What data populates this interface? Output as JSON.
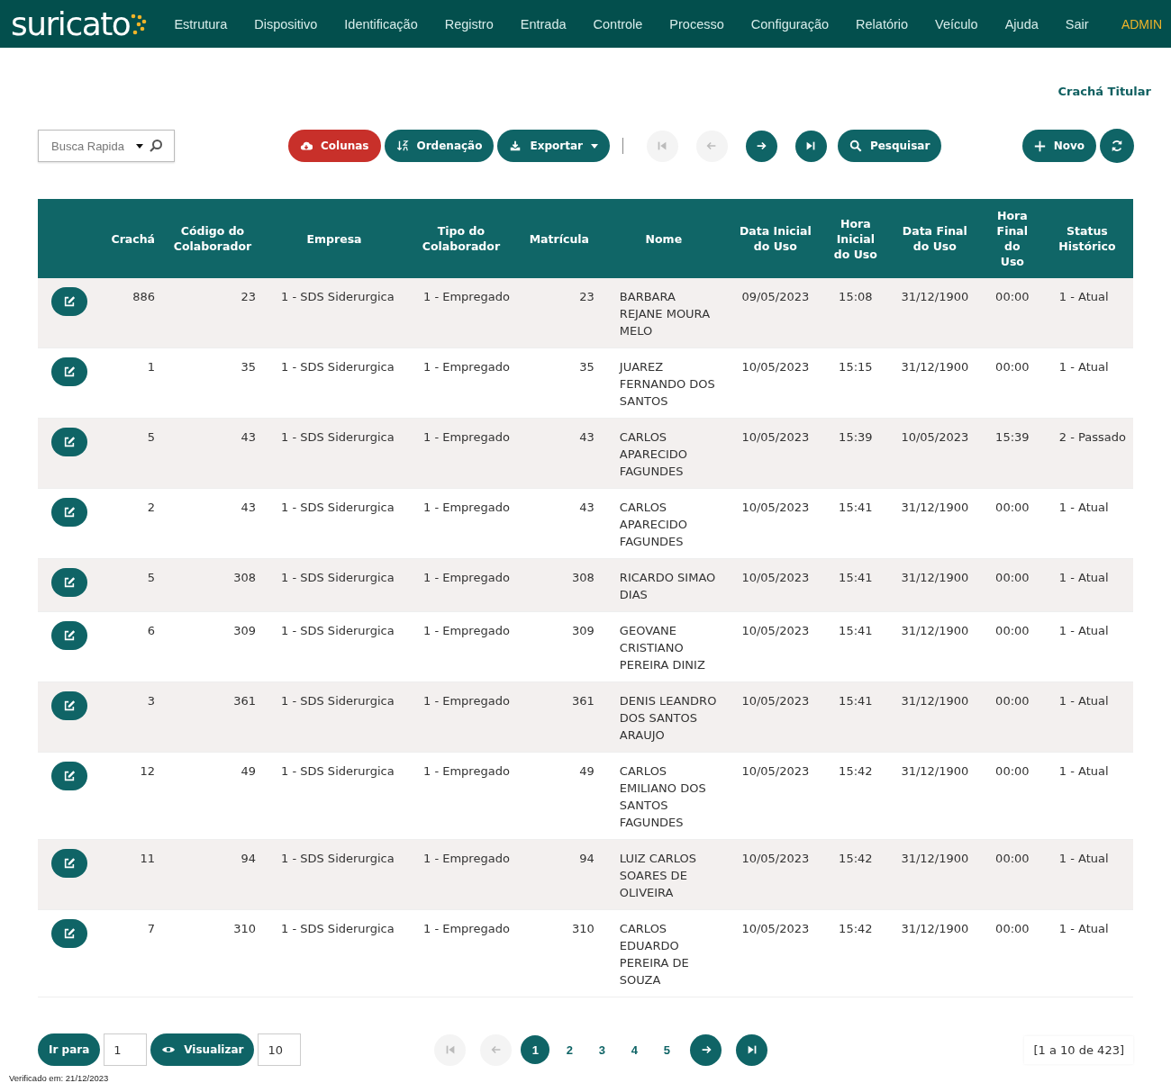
{
  "header": {
    "logo": "suricato",
    "menu": [
      "Estrutura",
      "Dispositivo",
      "Identificação",
      "Registro",
      "Entrada",
      "Controle",
      "Processo",
      "Configuração",
      "Relatório",
      "Veículo",
      "Ajuda",
      "Sair"
    ],
    "user": "ADMIN"
  },
  "page_title": "Crachá Titular",
  "search": {
    "placeholder": "Busca Rapida"
  },
  "toolbar": [
    {
      "kind": "cloud",
      "label": "Colunas",
      "color": "#c8302a"
    },
    {
      "kind": "sort",
      "label": "Ordenação",
      "color": "#0f6466"
    },
    {
      "kind": "export",
      "label": "Exportar",
      "color": "#0f6466"
    }
  ],
  "nav": [
    {
      "kind": "first",
      "disabled": true
    },
    {
      "kind": "prev",
      "disabled": true
    },
    {
      "kind": "next",
      "disabled": false
    },
    {
      "kind": "last",
      "disabled": false
    }
  ],
  "search_button": "Pesquisar",
  "new_button": "Novo",
  "table": {
    "columns": [
      "Crachá",
      "Código do Colaborador",
      "Empresa",
      "Tipo do Colaborador",
      "Matrícula",
      "Nome",
      "Data Inicial do Uso",
      "Hora Inicial do Uso",
      "Data Final do Uso",
      "Hora Final do Uso",
      "Status Histórico"
    ],
    "rows": [
      [
        "886",
        "23",
        "1 - SDS Siderurgica",
        "1 - Empregado",
        "23",
        "BARBARA REJANE MOURA MELO",
        "09/05/2023",
        "15:08",
        "31/12/1900",
        "00:00",
        "1 - Atual"
      ],
      [
        "1",
        "35",
        "1 - SDS Siderurgica",
        "1 - Empregado",
        "35",
        "JUAREZ FERNANDO DOS SANTOS",
        "10/05/2023",
        "15:15",
        "31/12/1900",
        "00:00",
        "1 - Atual"
      ],
      [
        "5",
        "43",
        "1 - SDS Siderurgica",
        "1 - Empregado",
        "43",
        "CARLOS APARECIDO FAGUNDES",
        "10/05/2023",
        "15:39",
        "10/05/2023",
        "15:39",
        "2 - Passado"
      ],
      [
        "2",
        "43",
        "1 - SDS Siderurgica",
        "1 - Empregado",
        "43",
        "CARLOS APARECIDO FAGUNDES",
        "10/05/2023",
        "15:41",
        "31/12/1900",
        "00:00",
        "1 - Atual"
      ],
      [
        "5",
        "308",
        "1 - SDS Siderurgica",
        "1 - Empregado",
        "308",
        "RICARDO SIMAO DIAS",
        "10/05/2023",
        "15:41",
        "31/12/1900",
        "00:00",
        "1 - Atual"
      ],
      [
        "6",
        "309",
        "1 - SDS Siderurgica",
        "1 - Empregado",
        "309",
        "GEOVANE CRISTIANO PEREIRA DINIZ",
        "10/05/2023",
        "15:41",
        "31/12/1900",
        "00:00",
        "1 - Atual"
      ],
      [
        "3",
        "361",
        "1 - SDS Siderurgica",
        "1 - Empregado",
        "361",
        "DENIS LEANDRO DOS SANTOS ARAUJO",
        "10/05/2023",
        "15:41",
        "31/12/1900",
        "00:00",
        "1 - Atual"
      ],
      [
        "12",
        "49",
        "1 - SDS Siderurgica",
        "1 - Empregado",
        "49",
        "CARLOS EMILIANO DOS SANTOS FAGUNDES",
        "10/05/2023",
        "15:42",
        "31/12/1900",
        "00:00",
        "1 - Atual"
      ],
      [
        "11",
        "94",
        "1 - SDS Siderurgica",
        "1 - Empregado",
        "94",
        "LUIZ CARLOS SOARES DE OLIVEIRA",
        "10/05/2023",
        "15:42",
        "31/12/1900",
        "00:00",
        "1 - Atual"
      ],
      [
        "7",
        "310",
        "1 - SDS Siderurgica",
        "1 - Empregado",
        "310",
        "CARLOS EDUARDO PEREIRA DE SOUZA",
        "10/05/2023",
        "15:42",
        "31/12/1900",
        "00:00",
        "1 - Atual"
      ]
    ]
  },
  "footer": {
    "goto_button": "Ir para",
    "goto_value": "1",
    "view_button": "Visualizar",
    "view_value": "10",
    "pager_nav": [
      {
        "kind": "first",
        "disabled": true
      },
      {
        "kind": "prev",
        "disabled": true
      }
    ],
    "pages": [
      {
        "label": "1",
        "selected": true
      },
      {
        "label": "2",
        "selected": false
      },
      {
        "label": "3",
        "selected": false
      },
      {
        "label": "4",
        "selected": false
      },
      {
        "label": "5",
        "selected": false
      }
    ],
    "pager_nav_end": [
      {
        "kind": "next",
        "disabled": false
      },
      {
        "kind": "last",
        "disabled": false
      }
    ],
    "range": "[1 a 10 de 423]",
    "verified": "Verificado em: 21/12/2023"
  }
}
